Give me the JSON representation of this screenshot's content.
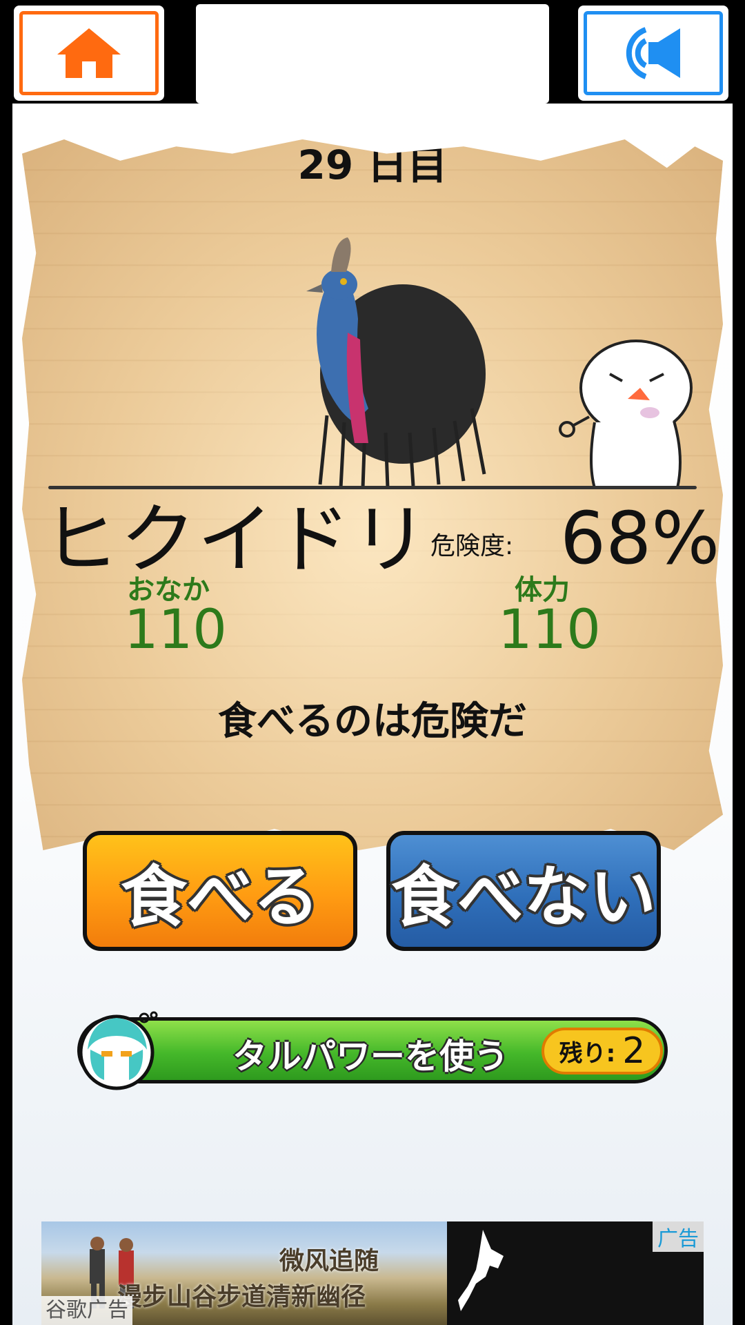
{
  "header": {
    "home_icon": "home-icon",
    "sound_icon": "speaker-icon",
    "accent_home": "#ff6a10",
    "accent_sound": "#1f8ff2"
  },
  "card": {
    "day_label": "29 日目",
    "animal_name": "ヒクイドリ",
    "danger_label": "危険度:",
    "danger_value": "68%",
    "stats": {
      "hunger_label": "おなか",
      "hunger_value": "110",
      "stamina_label": "体力",
      "stamina_value": "110"
    },
    "verdict": "食べるのは危険だ"
  },
  "actions": {
    "eat_label": "食べる",
    "noeat_label": "食べない",
    "eat_color": "#ff9b12",
    "noeat_color": "#2f6fba"
  },
  "power": {
    "label": "タルパワーを使う",
    "remaining_label": "残り:",
    "remaining_count": "2"
  },
  "ad": {
    "title": "微风追随",
    "subtitle": "漫步山谷步道清新幽径",
    "tag": "广告",
    "source": "谷歌广告"
  }
}
